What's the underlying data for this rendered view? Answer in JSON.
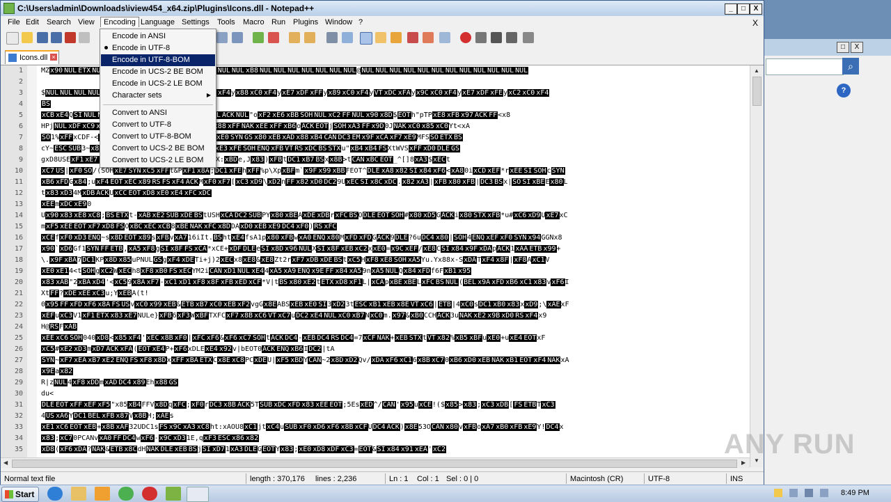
{
  "window": {
    "title": "C:\\Users\\admin\\Downloads\\iview454_x64.zip\\Plugins\\Icons.dll - Notepad++",
    "minimize": "_",
    "maximize": "□",
    "close": "X"
  },
  "menu": {
    "items": [
      "File",
      "Edit",
      "Search",
      "View",
      "Encoding",
      "Language",
      "Settings",
      "Tools",
      "Macro",
      "Run",
      "Plugins",
      "Window",
      "?"
    ],
    "close": "X"
  },
  "encoding_menu": {
    "items": [
      {
        "label": "Encode in ANSI"
      },
      {
        "label": "Encode in UTF-8",
        "checked": true
      },
      {
        "label": "Encode in UTF-8-BOM",
        "highlighted": true
      },
      {
        "label": "Encode in UCS-2 BE BOM"
      },
      {
        "label": "Encode in UCS-2 LE BOM"
      },
      {
        "label": "Character sets",
        "submenu": true
      },
      {
        "label": "Convert to ANSI"
      },
      {
        "label": "Convert to UTF-8"
      },
      {
        "label": "Convert to UTF-8-BOM"
      },
      {
        "label": "Convert to UCS-2 BE BOM"
      },
      {
        "label": "Convert to UCS-2 LE BOM"
      }
    ]
  },
  "tab": {
    "label": "Icons.dll",
    "close": "×"
  },
  "editor": {
    "lines": [
      {
        "n": "1",
        "text": "MZ x90 NUL ETX NUL NUL NUL EOT NUL NUL NUL xFF xFF NUL NUL xB8 NUL NUL NUL NUL NUL NUL NUL @ NUL NUL NUL NUL NUL NUL NUL NUL NUL NUL NUL NUL"
      },
      {
        "n": "2",
        "text": ""
      },
      {
        "n": "3",
        "text": "$ NUL NUL NUL NUL NUL NUL NUL x88 xC0 xF4 y x88 xC0 xF4 y x88 xC0 xF4 y xE7 xDF xFF y x89 xC0 xF4 y VT xDC xFA y x9C xC0 xF4 y xE7 xDF xFE y xC2 xC0 xF4"
      },
      {
        "n": "4",
        "text": "    BS"
      },
      {
        "n": "5",
        "text": "xCB xE4 Q SI NUL NUL NUL DD ? NUL NUL NUL x80 ACK NUL ACK NUL \"o xF2 xE6 xBB SOH NUL xC2 FF NUL x90 x8D $ EOT h\"pTP xE8 xFB x97 ACK FF < x8"
      },
      {
        "n": "6",
        "text": "HPj NUL xDF xC9 xC3 STX BS x83 xF8 SOH SI x85 x88 x88 xFF NAK xEE xFF xB6 o ACK EOT j SOH xA3 FF x9D 0J NAK xC0 x85 xC0 Yt < xA"
      },
      {
        "n": "7",
        "text": "SO 1% xFF xC DF - < xC1 xE0 BS ETX xC1 o4 FFwu DLE > xA xE0 SYN GS x80 xEB xAD x88 xB4 CAN DC3 EM x9F xCA xF7 xE9 MFS SO ETX BS"
      },
      {
        "n": "8",
        "text": "cY ~ ESC SUB 3 ~ x83 [ xF0 : DLE x85 xF6 x83 = x91 FF & xE3 xFE SOH ENQ xFB VT RS xDC BS STX u\" xB4 xB4 FS Xt WVS xFF xD0 DLE GS"
      },
      {
        "n": "9",
        "text": "gx D8 USE xF1 xE7 xC0 xCC xED 7WPG xF6 x8D xF2 < iETX : xBD e, J x83 ) xFB t DC1 xB7 BS x x8B > t CAN xBC EOT _^[] 8 xA3 $ xEC t"
      },
      {
        "n": "10",
        "text": "xC7 US | xF0 SO / (SOH xE7 SYN xC5 xFF t &P xF1 x8A ; DC1 xFE h xFF % p \\ Xp xBF m` x9F x99 xBB FEOT ^ DLE xA8 x82 SI x84 xF6 < xA8 0 i xCD xEF *r xEE SI SOH c SYN"
      },
      {
        "n": "11",
        "text": "xB6 xFD G x84 ; u xF4 EOT xEC x89 RS FS xF4 ACK M xF0 xF7 [ xC3 xD9 \\ xD2 n FF x82 xD0 DC2 9U xEC SI x8C xDC . x82 xA3 | xFB x80 xFB | DC3 BS x | SO SI xBE E x80 L"
      },
      {
        "n": "12",
        "text": "t x83 xD3 4 M xDB ACK U xCC EOT xD8 xE0 xE4 xFC xDC"
      },
      {
        "n": "13",
        "text": "xEE m xDC xE9 0"
      },
      {
        "n": "14",
        "text": "U x90 x83 xE8 xC8 ; BS ETX t - xAB xE2 SUB xDE BS t USH xCA DC2 SUB P Y x80 xBE A xDE xDB r xFC BS O DLE EOT SOH # x80 xD5 G ACK i x80 STX xFB *u # xC6 xD9 U xE7 xC"
      },
      {
        "n": "15",
        "text": "m xF5 xEE EOT xF7 xD8 FS O xBC xEC xCB 8 xBE NAK xFC x8D DA xD0 xEB xE9 DC4 xF0 ) RS xFC"
      },
      {
        "n": "16",
        "text": "xCE f xF0 xD3 ENQ ~ s x8D EOT x89 s xFB v xA7 16 i It. BS ht xE4 fsA1p x80 xFB w xA0 ENQ x80 M xFD xFD G ACK 9 DLE ?6 u DC4 x80 | SOH 4 ENQ xEF xF0 SYN x94 GGN x8"
      },
      {
        "n": "17",
        "text": "x90 ` xD6 Gf 1 SYN FF ETB , xA5 xF8 g SI x8F FS xCA *xCE + xDF DLE e SI x8D x96 NUL X SI x8F xEB xC2 x xE0 = x9C xEF / xE8 C SI x84 x9F xDA p ACK 1 xAA ETB x99 +"
      },
      {
        "n": "18",
        "text": "\\ . x9F xBA 7 DC1 KP x8D x85 u PNUL GS g xF4 xDE Ti+j ) 2 xEC x8 xE8 & xE8 Zt 2 r xF7 xDB xDE BS t xC5 H xF8 xE8 SOH xA5 Yu. Y x88x-S xDA T xF4 x8F | xF8 A xC1 V"
      },
      {
        "n": "19",
        "text": "xE0 xE1 4 < t SOH g xC2 W xEC h 8 xF8 xB0 FS xEC YM 2 i CAN xD1 NUL xE4 4 xA5 xA9 ENQ x9E FF x84 xA5 9 n xA5 NUL Q x84 xFD f 6F xB1 x95"
      },
      {
        "n": "20",
        "text": "x83 xAB \"2 xBA xD4 ' < xC5 9 x8A xF7 - xC1 xD1 xF8 x8F xFB xED xCF *V | t BS x80 xE2 t ETX xD8 xF1 L | xCA p xBE xBE L xFC BS NUL ( BEL x9A xFD xB6 xC1 x83 v xF6 I"
      },
      {
        "n": "21",
        "text": "Xt FF ? xDE xEE xC3 u ; Y xEB A ( t !"
      },
      {
        "n": "22",
        "text": "0 x95 FF xFD xF6 x8A FS US v xC0 x99 xEB & ETB xB7 xC0 xEB xF2 vgG x8E ABS xEB xE0 SI 3 xD2 3t ESC xB1 xEB x8E VT xC6 | ETB | 4 xC0 s DC1 xB0 x83 x xD9 ; \\ xAE xF"
      },
      {
        "n": "23",
        "text": "xEF u xC3 V 1 xF1 ETX x83 xE7 NULe } xFB 6 xF3 W xBF TXFC xF7 x8B xC6 VT xC7 u DC2 xE4 NUL xC0 xB7 N xC0 m. x97 & xB0 CCH ACK 3u NAK xE2 x9B xD0 RS xF4 x9"
      },
      {
        "n": "24",
        "text": "H@ RS F xAB"
      },
      {
        "n": "25",
        "text": "xEE xC6 SOH 040 xD8 < x85 xF4 ' xEC x8B xF0 | xFC xF6 & xF6 xC7 SOH t ACK DC4 - xEB DC4 RS DC4 = 7 xCF NAK + xEB STX t VT x82 % xB5 xBF u xE0 + u xE4 EOT xF"
      },
      {
        "n": "26",
        "text": "xC5 # xE2 xD3 m xD7 ACK xFA ( EOT xE4 P + xF6 xDL E xE4 x92 v | bEOT 0 ACK ENQ xB6 I DC2 | tA"
      },
      {
        "n": "27",
        "text": "SYN ~ xF7 xEA xB7 xE2 ENQ FS xF8 x8D x xFF xBA ETX C x8E xC8 PC xDE U | xF5 xBD Y CAN ~2 x8D xD2 Qv / xDA xF6 xC1 6 x8B xC7 0 xB6 xD0 xEB NAK xB1 EOT xF4 NAK xA"
      },
      {
        "n": "28",
        "text": "x9E a x82"
      },
      {
        "n": "29",
        "text": "R | z NUL 4 xF8 xDD m xAD DC4 x89 Eh x88 GS"
      },
      {
        "n": "30",
        "text": "du<"
      },
      {
        "n": "31",
        "text": "DLE EOT xFF xEF xF5 \"x85 xB4 FFV x8D q xFC ; xF0 r DC3 x8B ACK 5T SUB xDC xFD x83 xEE EOT ; 5Es xED ^/ CAN ' x95 u xCE ! ( $ x85 > x83 ; xC3 xDB [ FS ETB T xC3"
      },
      {
        "n": "32",
        "text": "4 US xA6 Y DC1 BEL xFB x87 V x8B H ; xAE s"
      },
      {
        "n": "33",
        "text": "xE1 xC6 EOT xEB + x8B xAF 32 UDC1 s FS x9C xA3 xC8 ht : xAO U8 xC1 jt xC4 u SUB xF0 xD6 xF6 x8B xCF U DC4 ACK ) x8E 53 O CAN x80 v xFB o xA7 xB0 xFB xE9 Y ! DC4 x"
      },
      {
        "n": "34",
        "text": "x83 ; xC7 0 PCAN v xA0 FF DC4 w xF6 - x9C xD3 1E , q xF3 ESC x86 x82"
      },
      {
        "n": "35",
        "text": "xD8 ( xF6 xDA ? NAK & ETB x8C dH NAK DLE xEB BS j SI xD7 1 xA3 DLE G EOT Y x83 ; xE0 xD8 xDF xC3 = EOT & SI x84 x91 xEA ' xC2"
      }
    ]
  },
  "statusbar": {
    "filetype": "Normal text file",
    "length": "length : 370,176",
    "lines": "lines : 2,236",
    "ln": "Ln : 1",
    "col": "Col : 1",
    "sel": "Sel : 0 | 0",
    "eol": "Macintosh (CR)",
    "encoding": "UTF-8",
    "mode": "INS"
  },
  "taskbar": {
    "start": "Start",
    "clock": "8:49 PM"
  },
  "watermark": "ANY RUN",
  "colors": {
    "title_gradient_top": "#dde9f7",
    "menu_highlight": "#0a246a",
    "tab_accent": "#f5a623",
    "control_char_bg": "#000000"
  }
}
